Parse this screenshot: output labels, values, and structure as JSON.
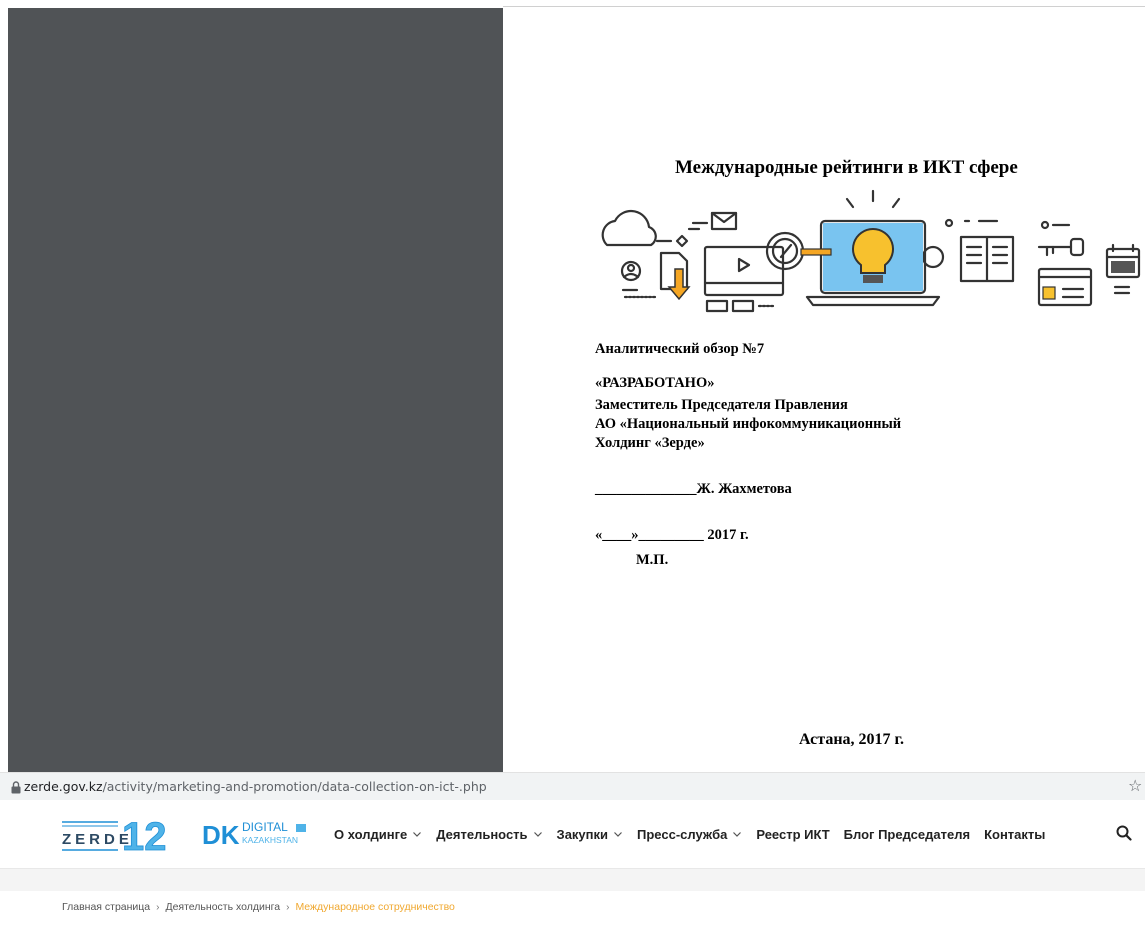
{
  "document": {
    "title": "Международные рейтинги в ИКТ сфере",
    "review_label": "Аналитический обзор №7",
    "approved_label": "«РАЗРАБОТАНО»",
    "signatory_position": "Заместитель Председателя Правления",
    "organization_line1": "АО «Национальный инфокоммуникационный",
    "organization_line2": "Холдинг «Зерде»",
    "signature_line": "______________Ж. Жахметова",
    "date_line": "«____»_________ 2017 г.",
    "seal_label": "М.П.",
    "city_year": "Астана, 2017 г."
  },
  "browser": {
    "url_host": "zerde.gov.kz",
    "url_path": "/activity/marketing-and-promotion/data-collection-on-ict-.php",
    "lock_icon": "lock-icon",
    "bookmark_icon": "star-icon",
    "bookmark_glyph": "☆"
  },
  "header": {
    "logo_zerde_text": "ZERDE",
    "logo_zerde_number": "12",
    "logo_dk_mark": "DK",
    "logo_dk_line1": "DIGITAL",
    "logo_dk_line2": "KAZAKHSTAN",
    "nav": [
      {
        "label": "О холдинге",
        "has_dropdown": true
      },
      {
        "label": "Деятельность",
        "has_dropdown": true
      },
      {
        "label": "Закупки",
        "has_dropdown": true
      },
      {
        "label": "Пресс-служба",
        "has_dropdown": true
      },
      {
        "label": "Реестр ИКТ",
        "has_dropdown": false
      },
      {
        "label": "Блог Председателя",
        "has_dropdown": false
      },
      {
        "label": "Контакты",
        "has_dropdown": false
      }
    ],
    "search_icon": "search-icon"
  },
  "breadcrumb": {
    "items": [
      "Главная страница",
      "Деятельность холдинга"
    ],
    "current": "Международное сотрудничество",
    "separator": "›"
  },
  "colors": {
    "dark_panel": "#505356",
    "accent_orange": "#f0a830",
    "logo_blue": "#1f8fd6"
  }
}
